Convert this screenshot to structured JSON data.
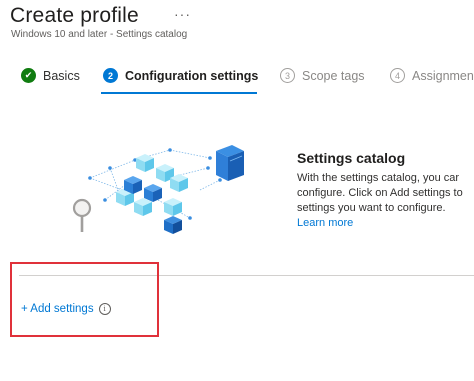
{
  "header": {
    "title": "Create profile",
    "more_label": "···",
    "subtitle": "Windows 10 and later - Settings catalog"
  },
  "wizard": {
    "steps": [
      {
        "number": "",
        "label": "Basics",
        "state": "completed"
      },
      {
        "number": "2",
        "label": "Configuration settings",
        "state": "active"
      },
      {
        "number": "3",
        "label": "Scope tags",
        "state": "upcoming"
      },
      {
        "number": "4",
        "label": "Assignmen",
        "state": "upcoming"
      }
    ],
    "check_glyph": "✔"
  },
  "catalog": {
    "title": "Settings catalog",
    "description_lines": [
      "With the settings catalog, you car",
      "configure. Click on Add settings to",
      "settings you want to configure."
    ],
    "learn_more": "Learn more"
  },
  "actions": {
    "add_settings_label": "+ Add settings",
    "info_glyph": "i"
  },
  "colors": {
    "accent": "#0078d4",
    "success": "#107c10",
    "highlight": "#e0313a"
  }
}
